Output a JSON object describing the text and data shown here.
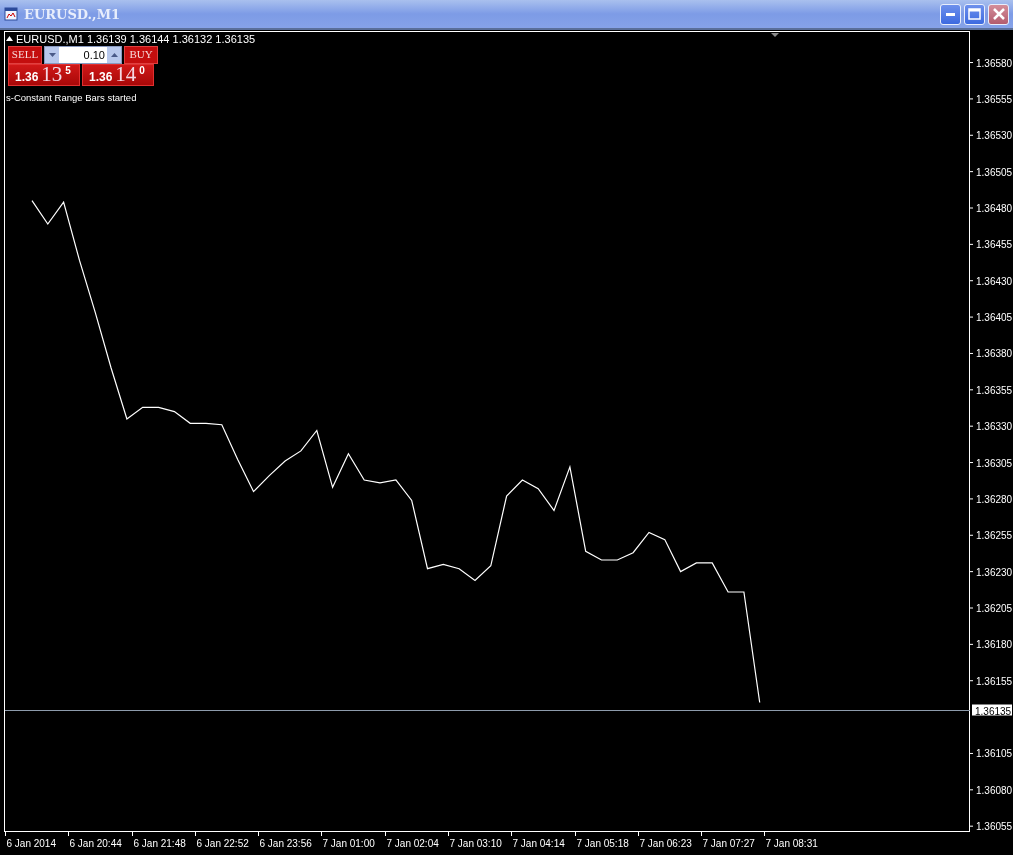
{
  "window": {
    "title": "EURUSD.,M1"
  },
  "chart_header": {
    "open": "1.36139",
    "high": "1.36144",
    "low": "1.36132",
    "close": "1.36135"
  },
  "trade_panel": {
    "sell_label": "SELL",
    "buy_label": "BUY",
    "lot": "0.10",
    "sell_price": {
      "base": "1.36",
      "pips": "13",
      "fraction": "5"
    },
    "buy_price": {
      "base": "1.36",
      "pips": "14",
      "fraction": "0"
    }
  },
  "message": "s-Constant Range Bars started",
  "chart": {
    "chart_data": {
      "type": "line",
      "categories": [
        "6 Jan 2014",
        null,
        null,
        null,
        "6 Jan 20:44",
        null,
        null,
        null,
        "6 Jan 21:48",
        null,
        null,
        null,
        "6 Jan 22:52",
        null,
        null,
        null,
        "6 Jan 23:56",
        null,
        null,
        null,
        "7 Jan 01:00",
        null,
        null,
        null,
        "7 Jan 02:04",
        null,
        null,
        null,
        "7 Jan 03:10",
        null,
        null,
        null,
        "7 Jan 04:14",
        null,
        null,
        null,
        "7 Jan 05:18",
        null,
        null,
        null,
        "7 Jan 06:23",
        null,
        null,
        null,
        "7 Jan 07:27",
        null,
        null,
        null,
        "7 Jan 08:31",
        null,
        null,
        null,
        null,
        null,
        null,
        null,
        null,
        null,
        null,
        null,
        null
      ],
      "series": [
        {
          "name": "EURUSD.,M1",
          "color": "#ffffff",
          "values": [
            1.36485,
            1.36469,
            1.36484,
            1.36444,
            1.36408,
            1.3637,
            1.36335,
            1.36343,
            1.36343,
            1.3634,
            1.36332,
            1.36332,
            1.36331,
            1.36307,
            1.36285,
            1.36296,
            1.36306,
            1.36313,
            1.36327,
            1.36288,
            1.36311,
            1.36293,
            1.36291,
            1.36293,
            1.36279,
            1.36232,
            1.36235,
            1.36232,
            1.36224,
            1.36234,
            1.36282,
            1.36293,
            1.36287,
            1.36272,
            1.36302,
            1.36244,
            1.36238,
            1.36238,
            1.36243,
            1.36257,
            1.36252,
            1.3623,
            1.36236,
            1.36236,
            1.36216,
            1.36216,
            1.3614,
            null,
            null,
            null,
            null,
            null,
            null,
            null,
            null,
            null,
            null,
            null,
            null,
            null,
            null
          ]
        }
      ],
      "ylim": [
        1.36051,
        1.36601
      ],
      "yticks": [
        {
          "value": 1.3658,
          "label": "1.36580"
        },
        {
          "value": 1.36555,
          "label": "1.36555"
        },
        {
          "value": 1.3653,
          "label": "1.36530"
        },
        {
          "value": 1.36505,
          "label": "1.36505"
        },
        {
          "value": 1.3648,
          "label": "1.36480"
        },
        {
          "value": 1.36455,
          "label": "1.36455"
        },
        {
          "value": 1.3643,
          "label": "1.36430"
        },
        {
          "value": 1.36405,
          "label": "1.36405"
        },
        {
          "value": 1.3638,
          "label": "1.36380"
        },
        {
          "value": 1.36355,
          "label": "1.36355"
        },
        {
          "value": 1.3633,
          "label": "1.36330"
        },
        {
          "value": 1.36305,
          "label": "1.36305"
        },
        {
          "value": 1.3628,
          "label": "1.36280"
        },
        {
          "value": 1.36255,
          "label": "1.36255"
        },
        {
          "value": 1.3623,
          "label": "1.36230"
        },
        {
          "value": 1.36205,
          "label": "1.36205"
        },
        {
          "value": 1.3618,
          "label": "1.36180"
        },
        {
          "value": 1.36155,
          "label": "1.36155"
        },
        {
          "value": 1.36105,
          "label": "1.36105"
        },
        {
          "value": 1.3608,
          "label": "1.36080"
        },
        {
          "value": 1.36055,
          "label": "1.36055"
        }
      ],
      "ref_lines": [
        {
          "axis": "y",
          "value": 1.36135,
          "label": "1.36135"
        }
      ]
    }
  }
}
